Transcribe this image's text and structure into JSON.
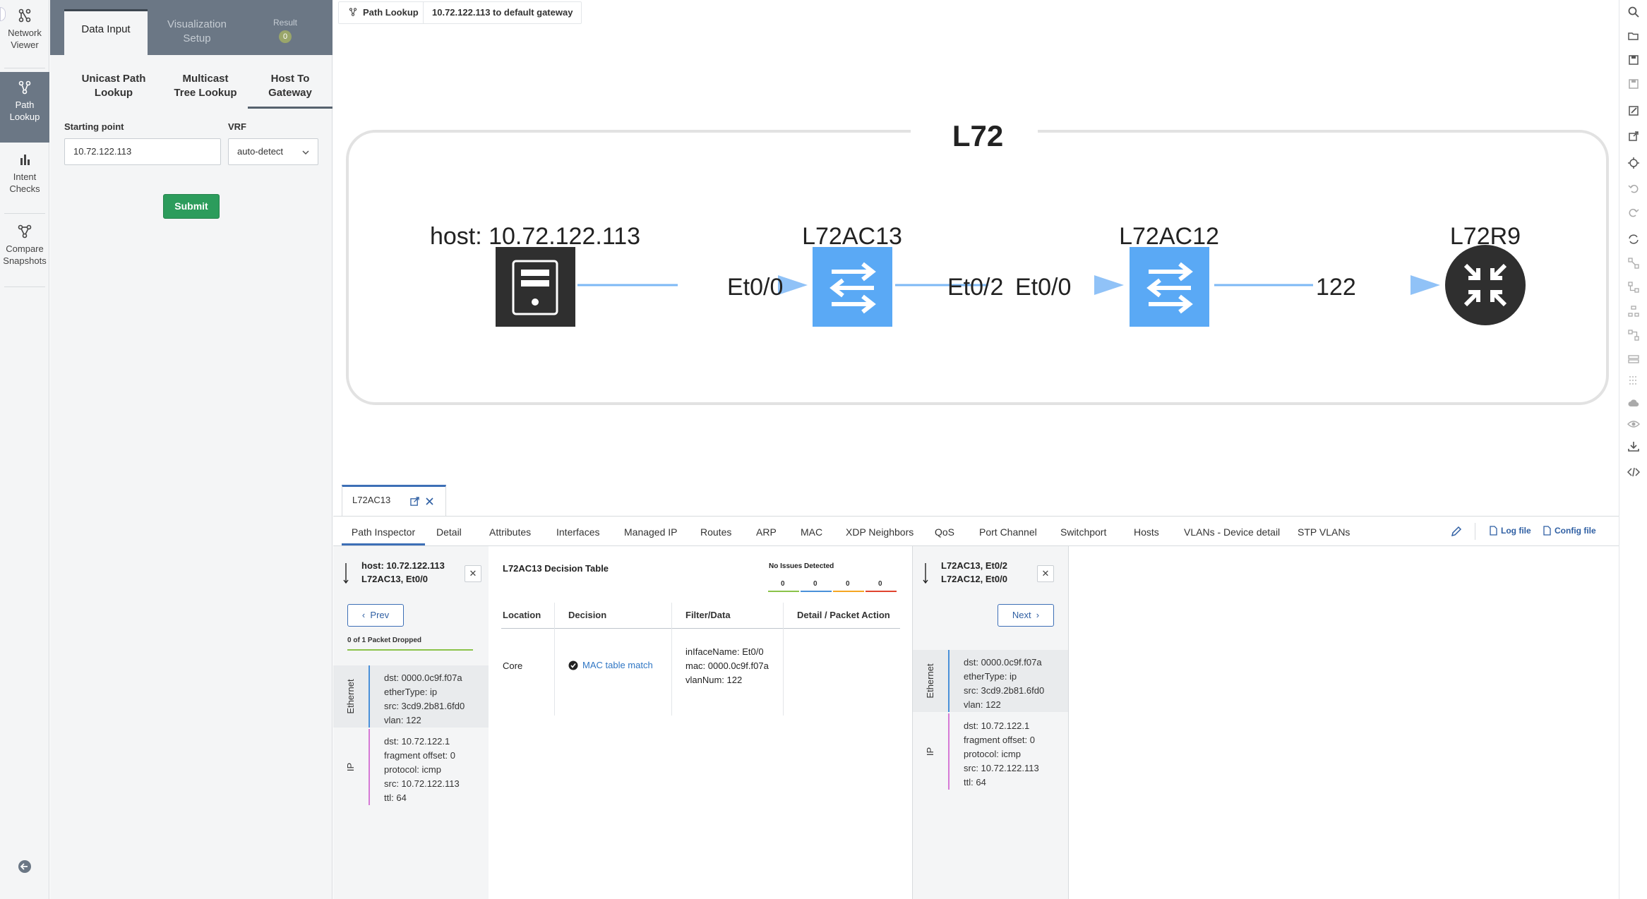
{
  "leftnav": {
    "items": [
      {
        "label": "Network Viewer",
        "active": false
      },
      {
        "label": "Path Lookup",
        "active": true
      },
      {
        "label": "Intent Checks",
        "active": false
      },
      {
        "label": "Compare Snapshots",
        "active": false
      }
    ]
  },
  "panel": {
    "tabs": {
      "data_input": "Data Input",
      "visualization_setup": "Visualization Setup",
      "result": "Result",
      "result_count": "0"
    },
    "subtabs": {
      "unicast": "Unicast Path Lookup",
      "multicast": "Multicast Tree Lookup",
      "host_gateway": "Host To Gateway"
    },
    "starting_point_label": "Starting point",
    "starting_point_value": "10.72.122.113",
    "vrf_label": "VRF",
    "vrf_value": "auto-detect",
    "submit_label": "Submit"
  },
  "breadcrumb": {
    "root": "Path Lookup",
    "current": "10.72.122.113 to default gateway"
  },
  "diagram": {
    "group_label": "L72",
    "nodes": [
      {
        "label": "host: 10.72.122.113",
        "type": "host"
      },
      {
        "label": "L72AC13",
        "type": "switch"
      },
      {
        "label": "L72AC12",
        "type": "switch"
      },
      {
        "label": "L72R9",
        "type": "router"
      }
    ],
    "edge_labels": [
      "Et0/0",
      "Et0/2",
      "Et0/0",
      "122"
    ],
    "colors": {
      "switch": "#5aa9f5",
      "host": "#2f2f2f",
      "router": "#2f2f2f",
      "edge": "#7db8f5"
    }
  },
  "bottom": {
    "device_tab": "L72AC13",
    "tabs": [
      "Path Inspector",
      "Detail",
      "Attributes",
      "Interfaces",
      "Managed IP",
      "Routes",
      "ARP",
      "MAC",
      "XDP Neighbors",
      "QoS",
      "Port Channel",
      "Switchport",
      "Hosts",
      "VLANs - Device detail",
      "STP VLANs"
    ],
    "log_file": "Log file",
    "config_file": "Config file",
    "left_hop": {
      "line1": "host: 10.72.122.113",
      "line2": "L72AC13, Et0/0",
      "prev_label": "Prev",
      "dropped": "0 of 1 Packet Dropped"
    },
    "right_hop": {
      "line1": "L72AC13, Et0/2",
      "line2": "L72AC12, Et0/0",
      "next_label": "Next"
    },
    "headers_left": {
      "ethernet_label": "Ethernet",
      "ethernet": [
        "dst: 0000.0c9f.f07a",
        "etherType: ip",
        "src: 3cd9.2b81.6fd0",
        "vlan: 122"
      ],
      "ip_label": "IP",
      "ip": [
        "dst: 10.72.122.1",
        "fragment offset: 0",
        "protocol: icmp",
        "src: 10.72.122.113",
        "ttl: 64"
      ]
    },
    "headers_right": {
      "ethernet_label": "Ethernet",
      "ethernet": [
        "dst: 0000.0c9f.f07a",
        "etherType: ip",
        "src: 3cd9.2b81.6fd0",
        "vlan: 122"
      ],
      "ip_label": "IP",
      "ip": [
        "dst: 10.72.122.1",
        "fragment offset: 0",
        "protocol: icmp",
        "src: 10.72.122.113",
        "ttl: 64"
      ]
    },
    "decision_table": {
      "title": "L72AC13 Decision Table",
      "no_issues": "No Issues Detected",
      "issue_counts": [
        "0",
        "0",
        "0",
        "0"
      ],
      "issue_colors": [
        "#8bc34a",
        "#4a90d9",
        "#f5a623",
        "#e0442f"
      ],
      "columns": [
        "Location",
        "Decision",
        "Filter/Data",
        "Detail / Packet Action"
      ],
      "row": {
        "location": "Core",
        "decision": "MAC table match",
        "filter": [
          "inIfaceName: Et0/0",
          "mac: 0000.0c9f.f07a",
          "vlanNum: 122"
        ],
        "detail": ""
      }
    }
  }
}
